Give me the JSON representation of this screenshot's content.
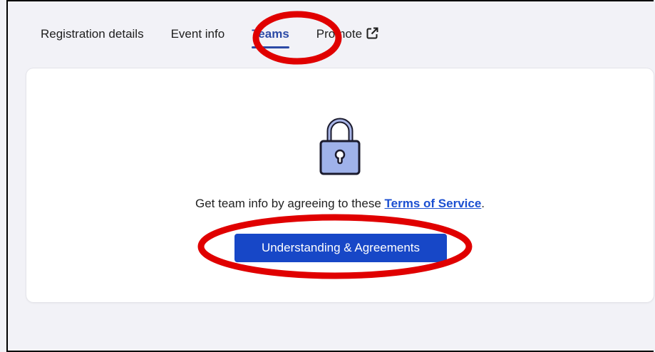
{
  "tabs": [
    {
      "label": "Registration details",
      "active": false
    },
    {
      "label": "Event info",
      "active": false
    },
    {
      "label": "Teams",
      "active": true
    },
    {
      "label": "Promote",
      "active": false,
      "icon": "external-link-icon"
    }
  ],
  "card": {
    "icon": "padlock-icon",
    "message_prefix": "Get team info by agreeing to these ",
    "terms_link": "Terms of Service",
    "message_suffix": ".",
    "button_label": "Understanding & Agreements"
  },
  "colors": {
    "accent": "#2c4aa6",
    "button": "#1747c7",
    "link": "#1b4fd1",
    "annotation": "#e00000"
  }
}
